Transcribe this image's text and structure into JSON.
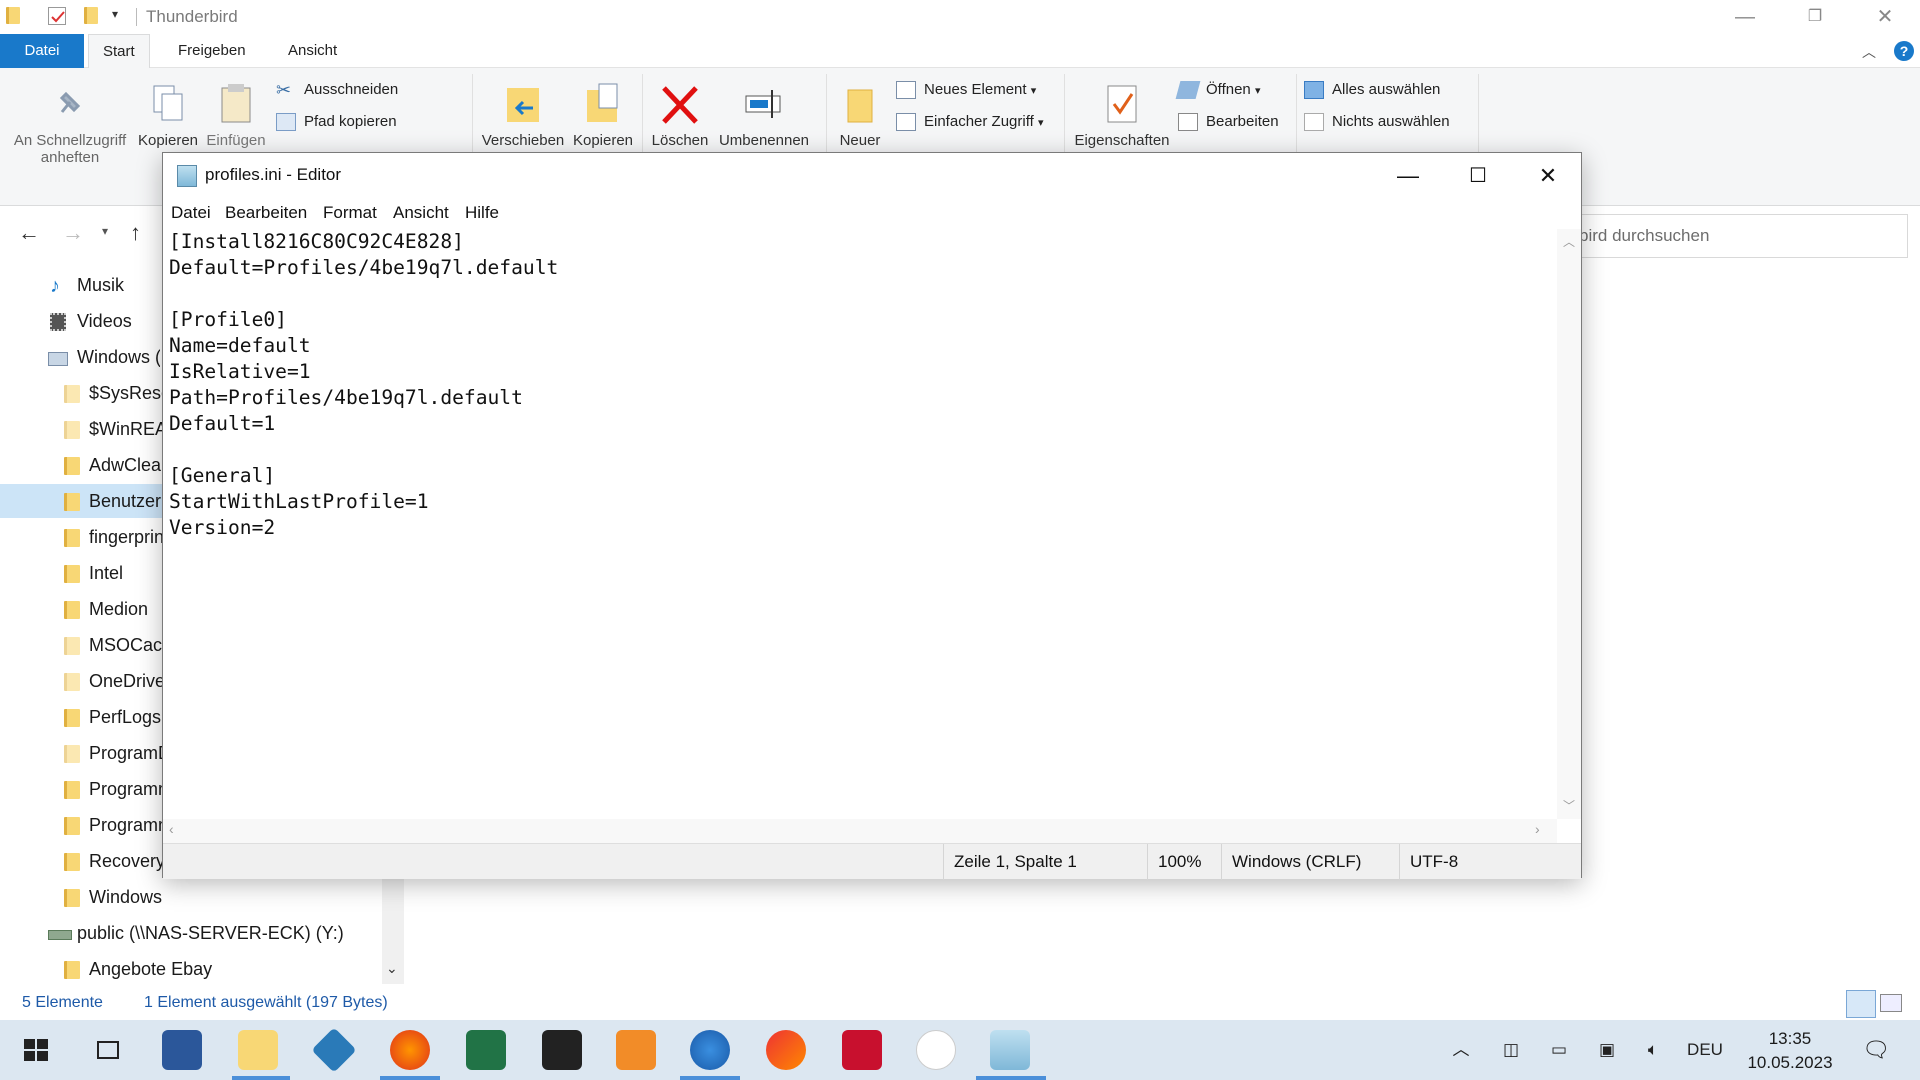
{
  "explorer": {
    "title": "Thunderbird",
    "tabs": [
      "Datei",
      "Start",
      "Freigeben",
      "Ansicht"
    ],
    "ribbon": {
      "pin": "An Schnellzugriff anheften",
      "copy": "Kopieren",
      "paste": "Einfügen",
      "cut": "Ausschneiden",
      "copy_path": "Pfad kopieren",
      "move_to": "Verschieben",
      "copy_to": "Kopieren",
      "delete": "Löschen",
      "rename": "Umbenennen",
      "new_folder": "Neuer",
      "new_item": "Neues Element",
      "easy_access": "Einfacher Zugriff",
      "properties": "Eigenschaften",
      "open": "Öffnen",
      "edit": "Bearbeiten",
      "select_all": "Alles auswählen",
      "select_none": "Nichts auswählen"
    },
    "search_placeholder": "bird durchsuchen",
    "nav_items": [
      "Musik",
      "Videos",
      "Windows (",
      "$SysReset",
      "$WinREA",
      "AdwCleaner",
      "Benutzer",
      "fingerprint",
      "Intel",
      "Medion",
      "MSOCache",
      "OneDrive",
      "PerfLogs",
      "ProgramData",
      "Programme",
      "Programme",
      "Recovery",
      "Windows",
      "public (\\\\NAS-SERVER-ECK) (Y:)",
      "Angebote Ebay"
    ],
    "status": {
      "count": "5 Elemente",
      "selection": "1 Element ausgewählt (197 Bytes)"
    }
  },
  "notepad": {
    "title": "profiles.ini - Editor",
    "menu": [
      "Datei",
      "Bearbeiten",
      "Format",
      "Ansicht",
      "Hilfe"
    ],
    "content": "[Install8216C80C92C4E828]\nDefault=Profiles/4be19q7l.default\n\n[Profile0]\nName=default\nIsRelative=1\nPath=Profiles/4be19q7l.default\nDefault=1\n\n[General]\nStartWithLastProfile=1\nVersion=2",
    "status": {
      "position": "Zeile 1, Spalte 1",
      "zoom": "100%",
      "line_endings": "Windows (CRLF)",
      "encoding": "UTF-8"
    }
  },
  "taskbar": {
    "language": "DEU",
    "time": "13:35",
    "date": "10.05.2023"
  }
}
